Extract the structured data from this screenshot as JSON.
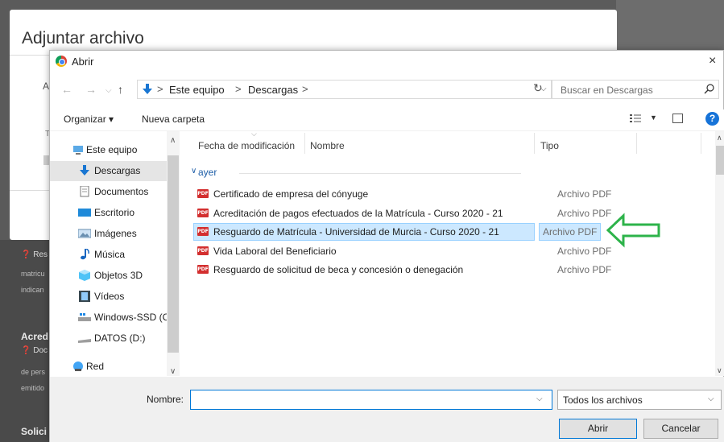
{
  "background": {
    "modal_title": "Adjuntar archivo",
    "fragments": {
      "a1": "A",
      "t1": "T",
      "res": "Res",
      "matricu": "matricu",
      "indican": "indican",
      "acred": "Acred",
      "doc": "Doc",
      "depers": "de pers",
      "emitido": "emitido",
      "solici": "Solici"
    }
  },
  "dialog": {
    "title": "Abrir",
    "address": {
      "crumbs": [
        "Este equipo",
        "Descargas"
      ],
      "separator": ">"
    },
    "search_placeholder": "Buscar en Descargas",
    "toolbar": {
      "organize": "Organizar ▾",
      "new_folder": "Nueva carpeta"
    },
    "nav": [
      {
        "label": "Este equipo",
        "icon": "pc-icon"
      },
      {
        "label": "Descargas",
        "icon": "download-icon",
        "selected": true
      },
      {
        "label": "Documentos",
        "icon": "documents-icon"
      },
      {
        "label": "Escritorio",
        "icon": "desktop-icon"
      },
      {
        "label": "Imágenes",
        "icon": "images-icon"
      },
      {
        "label": "Música",
        "icon": "music-icon"
      },
      {
        "label": "Objetos 3D",
        "icon": "3d-objects-icon"
      },
      {
        "label": "Vídeos",
        "icon": "videos-icon"
      },
      {
        "label": "Windows-SSD (C",
        "icon": "drive-icon"
      },
      {
        "label": "DATOS (D:)",
        "icon": "drive-icon"
      },
      {
        "label": "Red",
        "icon": "network-icon"
      }
    ],
    "columns": {
      "date": "Fecha de modificación",
      "name": "Nombre",
      "type": "Tipo"
    },
    "group": "ayer",
    "files": [
      {
        "name": "Certificado de empresa del cónyuge",
        "type": "Archivo PDF"
      },
      {
        "name": "Acreditación de pagos efectuados de la Matrícula - Curso 2020 - 21",
        "type": "Archivo PDF"
      },
      {
        "name": "Resguardo de Matrícula - Universidad de Murcia - Curso 2020 - 21",
        "type": "Archivo PDF",
        "selected": true
      },
      {
        "name": "Vida Laboral del Beneficiario",
        "type": "Archivo PDF"
      },
      {
        "name": "Resguardo de solicitud de beca y concesión o denegación",
        "type": "Archivo PDF"
      }
    ],
    "pdf_badge": "PDF",
    "filename_label": "Nombre:",
    "filename_value": "",
    "filter": "Todos los archivos",
    "open_button": "Abrir",
    "cancel_button": "Cancelar",
    "help_glyph": "?",
    "close_glyph": "×"
  },
  "colors": {
    "accent": "#0078d7",
    "selection": "#cce8ff",
    "annotation_arrow": "#2db34a",
    "pdf_icon": "#d32f2f"
  }
}
